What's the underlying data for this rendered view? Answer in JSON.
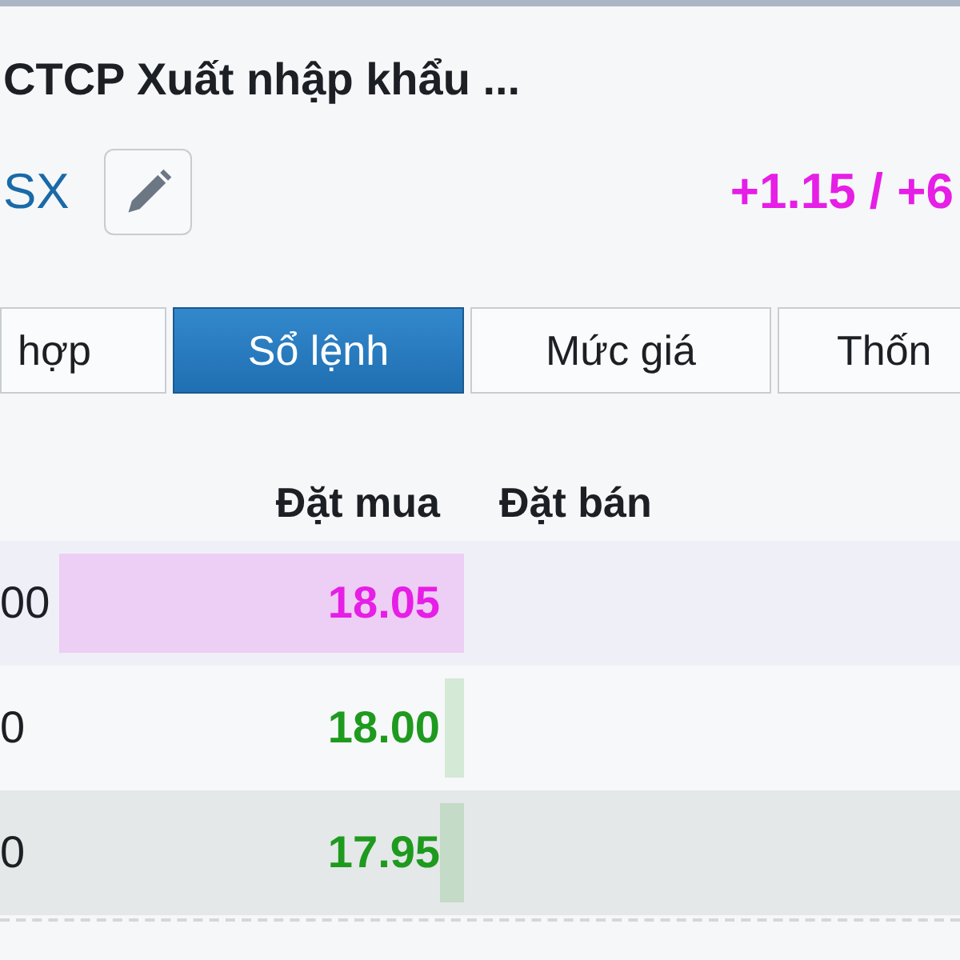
{
  "stock": {
    "name": "CTCP Xuất nhập khẩu ...",
    "exchange": "SX",
    "change": "+1.15 / +6"
  },
  "tabs": [
    {
      "label": "hợp",
      "selected": false
    },
    {
      "label": "Sổ lệnh",
      "selected": true
    },
    {
      "label": "Mức giá",
      "selected": false
    },
    {
      "label": "Thốn",
      "selected": false
    }
  ],
  "order_book": {
    "columns": [
      "Đặt mua",
      "Đặt bán"
    ],
    "rows": [
      {
        "volume": "00",
        "bid": "18.05",
        "color": "#e61ee6"
      },
      {
        "volume": "0",
        "bid": "18.00",
        "color": "#1e9a1e"
      },
      {
        "volume": "0",
        "bid": "17.95",
        "color": "#1e9a1e"
      }
    ]
  }
}
